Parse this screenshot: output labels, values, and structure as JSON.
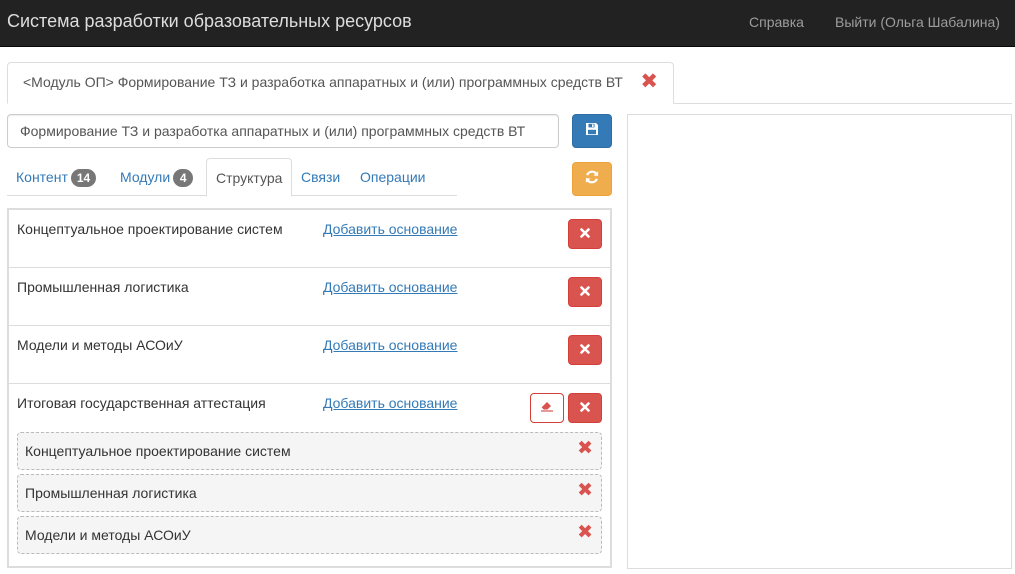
{
  "navbar": {
    "title": "Система разработки образовательных ресурсов",
    "help_label": "Справка",
    "logout_label": "Выйти (Ольга Шабалина)"
  },
  "doc_tab": {
    "label": "<Модуль ОП> Формирование ТЗ и разработка аппаратных и (или) программных средств ВТ",
    "close_glyph": "✖"
  },
  "editor": {
    "name_value": "Формирование ТЗ и разработка аппаратных и (или) программных средств ВТ"
  },
  "subtabs": [
    {
      "label": "Контент",
      "badge": "14"
    },
    {
      "label": "Модули",
      "badge": "4"
    },
    {
      "label": "Структура"
    },
    {
      "label": "Связи"
    },
    {
      "label": "Операции"
    }
  ],
  "active_subtab": "Структура",
  "structure": {
    "add_basis_label": "Добавить основание",
    "rows": [
      {
        "label": "Концептуальное проектирование систем"
      },
      {
        "label": "Промышленная логистика"
      },
      {
        "label": "Модели и методы АСОиУ"
      },
      {
        "label": "Итоговая государственная аттестация",
        "children": [
          {
            "label": "Концептуальное проектирование систем"
          },
          {
            "label": "Промышленная логистика"
          },
          {
            "label": "Модели и методы АСОиУ"
          }
        ]
      }
    ]
  },
  "icons": {
    "close": "close-icon",
    "save": "floppy-disk-icon",
    "refresh": "refresh-icon",
    "eraser": "eraser-icon",
    "remove": "remove-icon"
  },
  "colors": {
    "navbar_bg": "#222222",
    "primary": "#337ab7",
    "warning": "#f0ad4e",
    "danger": "#d9534f"
  }
}
